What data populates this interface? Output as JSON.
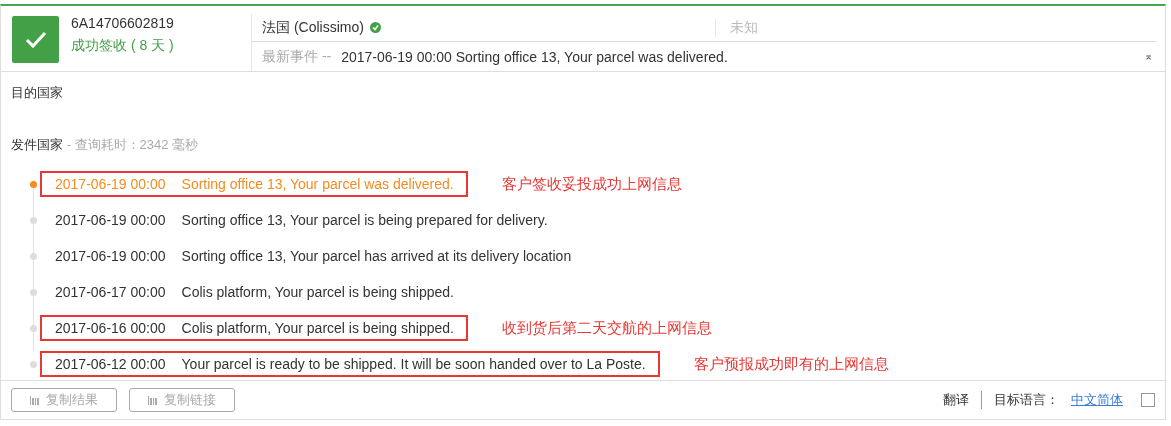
{
  "header": {
    "status_delivered": true,
    "tracking_number": "6A14706602819",
    "status_text": "成功签收 ( 8 天 )",
    "carrier": "法国 (Colissimo)",
    "carrier_verified": true,
    "unknown": "未知",
    "latest_label": "最新事件 --",
    "latest_event": "2017-06-19 00:00 Sorting office 13, Your parcel was delivered.",
    "collapse_icon": "⌅"
  },
  "destination_label": "目的国家",
  "origin_label": "发件国家",
  "query_time": "- 查询耗时：2342 毫秒",
  "events": [
    {
      "time": "2017-06-19 00:00",
      "text": "Sorting office 13, Your parcel was delivered.",
      "latest": true,
      "boxed": true,
      "note": "客户签收妥投成功上网信息"
    },
    {
      "time": "2017-06-19 00:00",
      "text": "Sorting office 13, Your parcel is being prepared for delivery.",
      "latest": false,
      "boxed": false
    },
    {
      "time": "2017-06-19 00:00",
      "text": "Sorting office 13, Your parcel has arrived at its delivery location",
      "latest": false,
      "boxed": false
    },
    {
      "time": "2017-06-17 00:00",
      "text": "Colis platform, Your parcel is being shipped.",
      "latest": false,
      "boxed": false
    },
    {
      "time": "2017-06-16 00:00",
      "text": "Colis platform, Your parcel is being shipped.",
      "latest": false,
      "boxed": true,
      "note": "收到货后第二天交航的上网信息"
    },
    {
      "time": "2017-06-12 00:00",
      "text": "Your parcel is ready to be shipped. It will be soon handed over to La Poste.",
      "latest": false,
      "boxed": true,
      "note": "客户预报成功即有的上网信息"
    }
  ],
  "footer": {
    "buttons": [
      "复制结果",
      "复制链接"
    ],
    "translate": "翻译",
    "target_label": "目标语言：",
    "language": "中文简体",
    "checked": false
  }
}
